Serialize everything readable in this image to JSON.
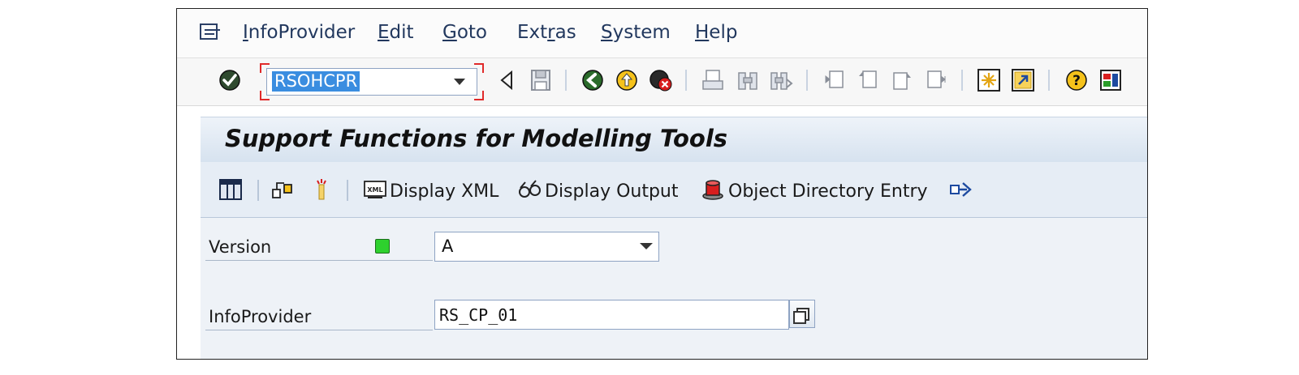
{
  "menubar": {
    "items": [
      {
        "label": "InfoProvider",
        "underline": "I",
        "rest": "nfoProvider"
      },
      {
        "label": "Edit",
        "underline": "E",
        "rest": "dit"
      },
      {
        "label": "Goto",
        "underline": "G",
        "rest": "oto"
      },
      {
        "label": "Extras",
        "pre": "Ext",
        "underline": "r",
        "rest": "as"
      },
      {
        "label": "System",
        "underline": "S",
        "rest": "ystem"
      },
      {
        "label": "Help",
        "underline": "H",
        "rest": "elp"
      }
    ]
  },
  "toolbar": {
    "command_value": "RSOHCPR",
    "icons": [
      "enter-icon",
      "back-triangle-icon",
      "save-icon",
      "back-icon",
      "exit-icon",
      "cancel-icon",
      "print-icon",
      "find-icon",
      "find-next-icon",
      "first-page-icon",
      "previous-page-icon",
      "next-page-icon",
      "last-page-icon",
      "create-session-icon",
      "shortcut-icon",
      "help-icon",
      "layout-icon"
    ]
  },
  "title": {
    "text": "Support Functions for Modelling Tools"
  },
  "app_toolbar": {
    "display_xml": "Display XML",
    "display_output": "Display Output",
    "object_directory_entry": "Object Directory Entry"
  },
  "form": {
    "version_label": "Version",
    "version_value": "A",
    "infoprovider_label": "InfoProvider",
    "infoprovider_value": "RS_CP_01"
  },
  "colors": {
    "accent_selection": "#3a8de0",
    "status_green": "#2ed12e",
    "command_focus": "#e02a2a"
  }
}
